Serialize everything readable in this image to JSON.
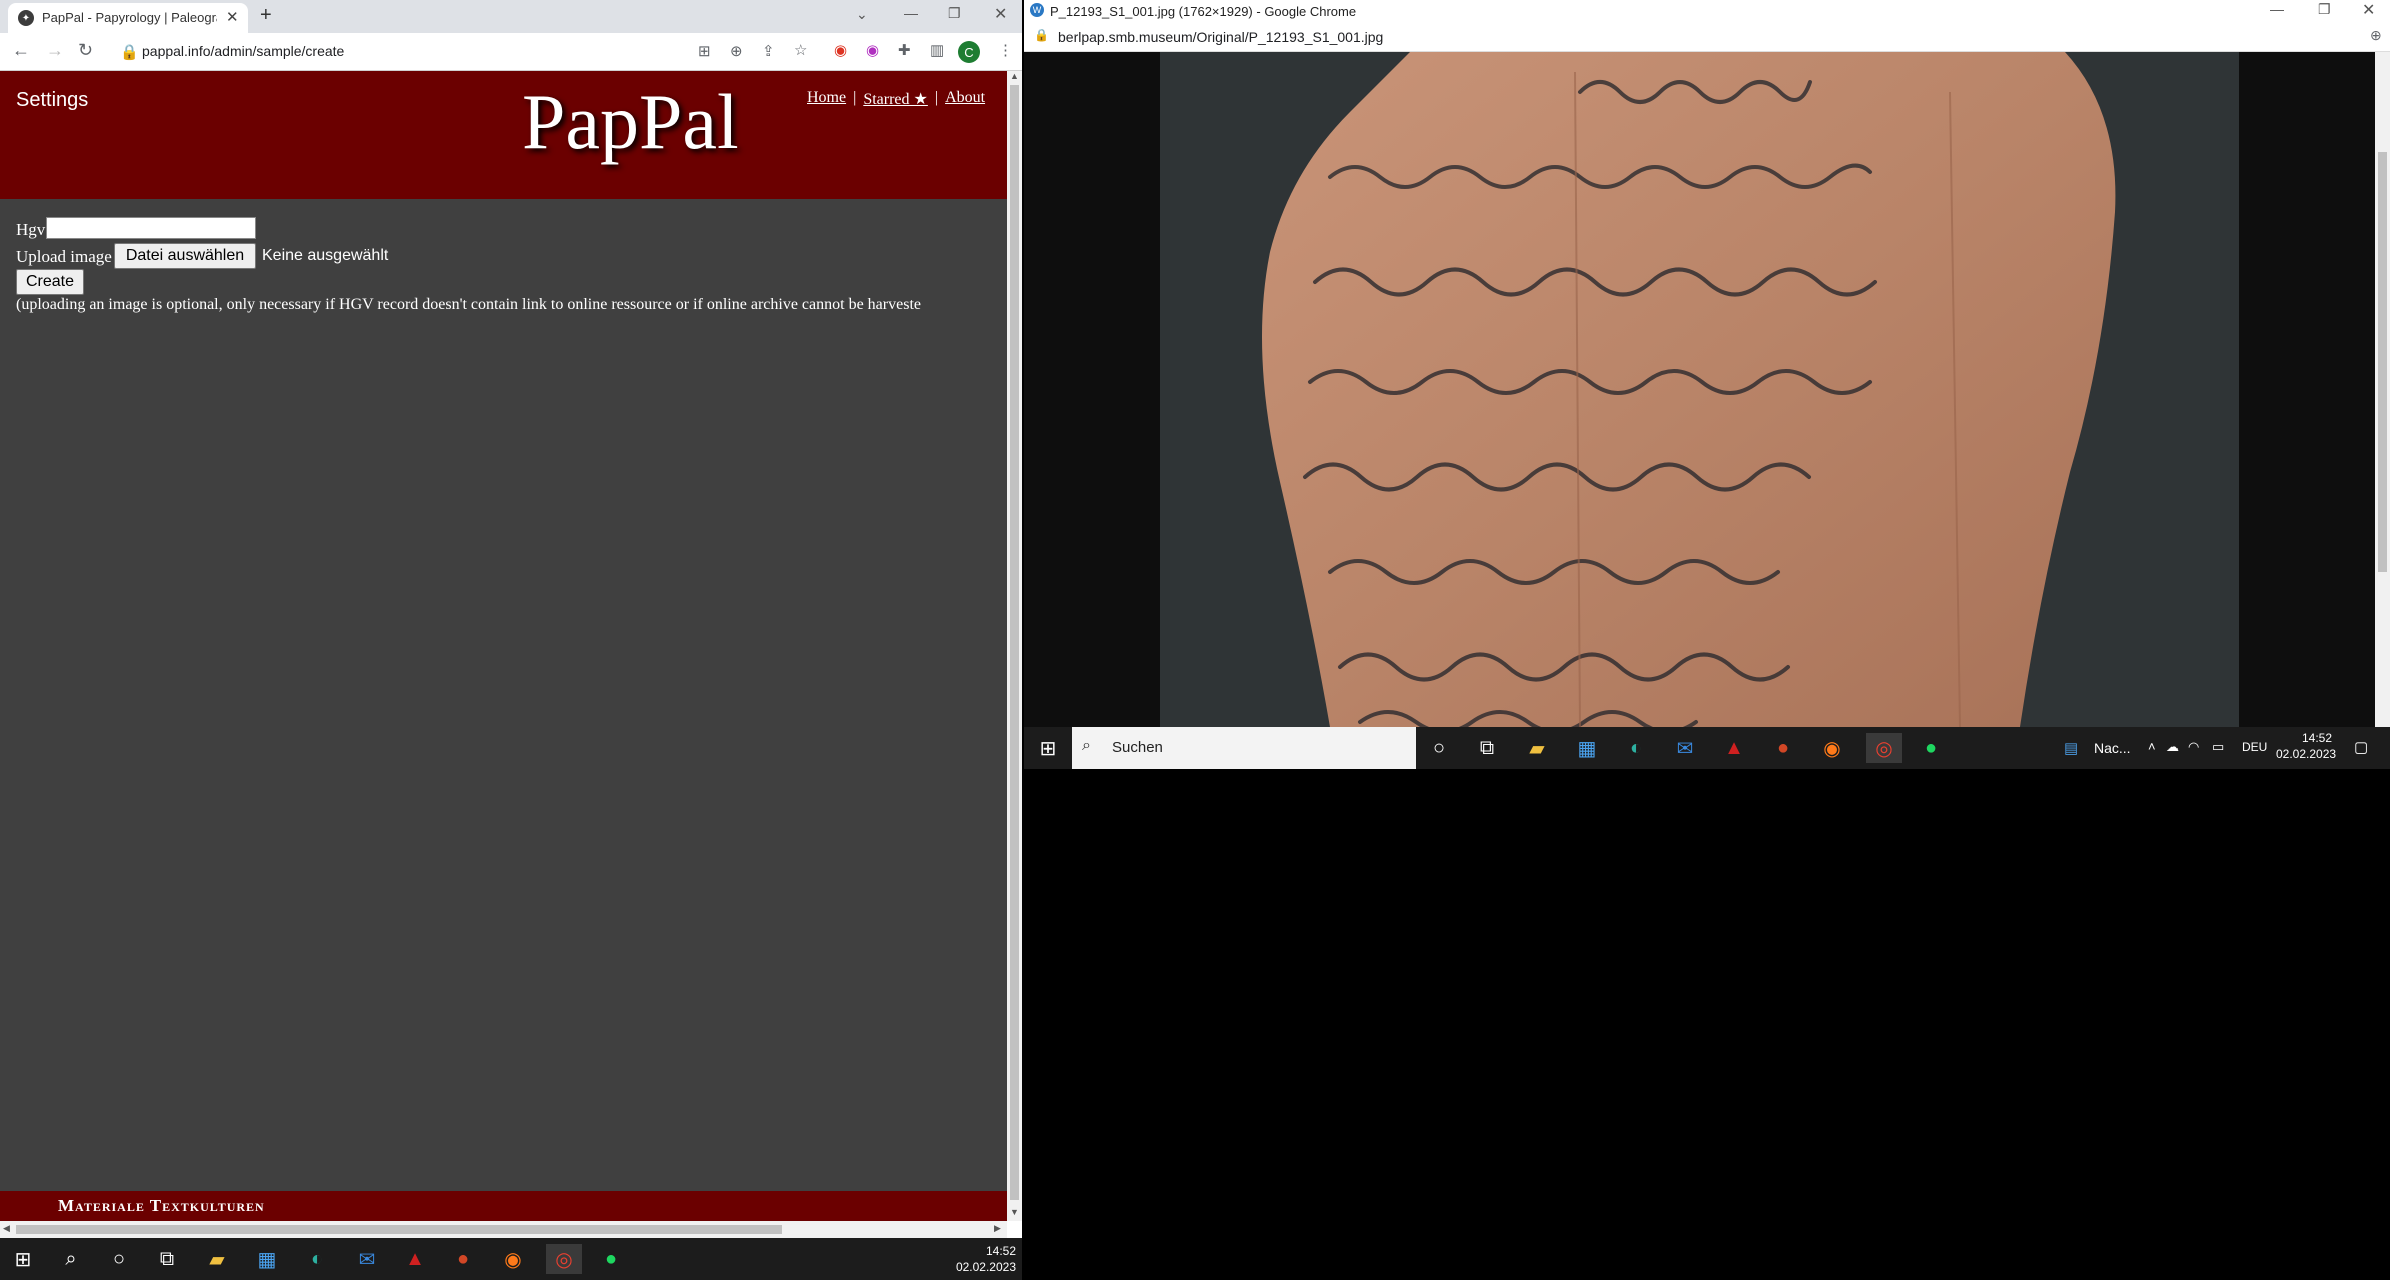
{
  "left_window": {
    "tab_title": "PapPal - Papyrology | Paleography",
    "tab_close": "✕",
    "new_tab": "+",
    "url": "pappal.info/admin/sample/create",
    "profile_initial": "C",
    "page": {
      "settings_label": "Settings",
      "logo": "PapPal",
      "nav": {
        "home": "Home",
        "starred": "Starred ★",
        "about": "About",
        "sep": "|"
      },
      "hgv_label": "Hgv",
      "hgv_value": "",
      "upload_label": "Upload image",
      "choose_file_button": "Datei auswählen",
      "no_file_text": "Keine ausgewählt",
      "create_button": "Create",
      "note": "(uploading an image is optional, only necessary if HGV record doesn't contain link to online ressource or if online archive cannot be harveste",
      "footer_text": "Materiale Textkulturen"
    }
  },
  "left_taskbar": {
    "time": "14:52",
    "date": "02.02.2023"
  },
  "right_window": {
    "title": "P_12193_S1_001.jpg (1762×1929) - Google Chrome",
    "url": "berlpap.smb.museum/Original/P_12193_S1_001.jpg"
  },
  "right_taskbar": {
    "search_placeholder": "Suchen",
    "news": "Nac...",
    "lang": "DEU",
    "time": "14:52",
    "date": "02.02.2023"
  },
  "colors": {
    "header_red": "#6b0000",
    "page_bg": "#404040",
    "taskbar": "#1c1c1c"
  }
}
